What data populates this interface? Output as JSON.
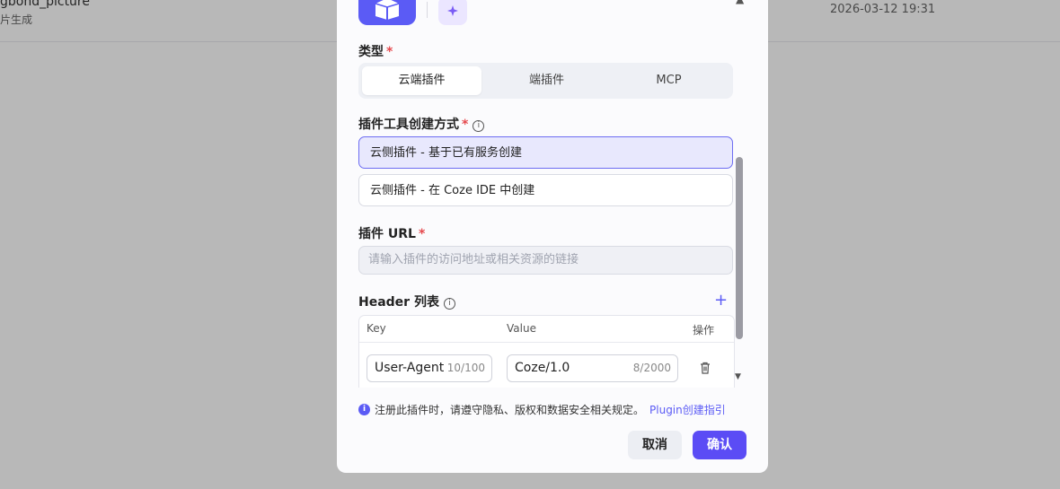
{
  "background": {
    "row_title": "gbond_picture",
    "row_subtitle": "片生成",
    "row_date": "2026-03-12 19:31"
  },
  "modal": {
    "type_label": "类型",
    "type_tabs": [
      "云端插件",
      "端插件",
      "MCP"
    ],
    "creation_label": "插件工具创建方式",
    "creation_options": [
      "云侧插件 - 基于已有服务创建",
      "云侧插件 - 在 Coze IDE 中创建"
    ],
    "url_label": "插件 URL",
    "url_placeholder": "请输入插件的访问地址或相关资源的链接",
    "header_label": "Header 列表",
    "header_columns": [
      "Key",
      "Value",
      "操作"
    ],
    "header_rows": [
      {
        "key": "User-Agent",
        "key_count": "10/100",
        "value": "Coze/1.0",
        "value_count": "8/2000"
      }
    ],
    "notice_text": "注册此插件时，请遵守隐私、版权和数据安全相关规定。",
    "notice_link": "Plugin创建指引",
    "cancel_label": "取消",
    "confirm_label": "确认",
    "required_mark": "*",
    "info_glyph": "i",
    "plus_glyph": "+"
  },
  "colors": {
    "accent": "#5b5bf5",
    "required": "#e5484d",
    "selected_bg": "#e8e8fd"
  }
}
